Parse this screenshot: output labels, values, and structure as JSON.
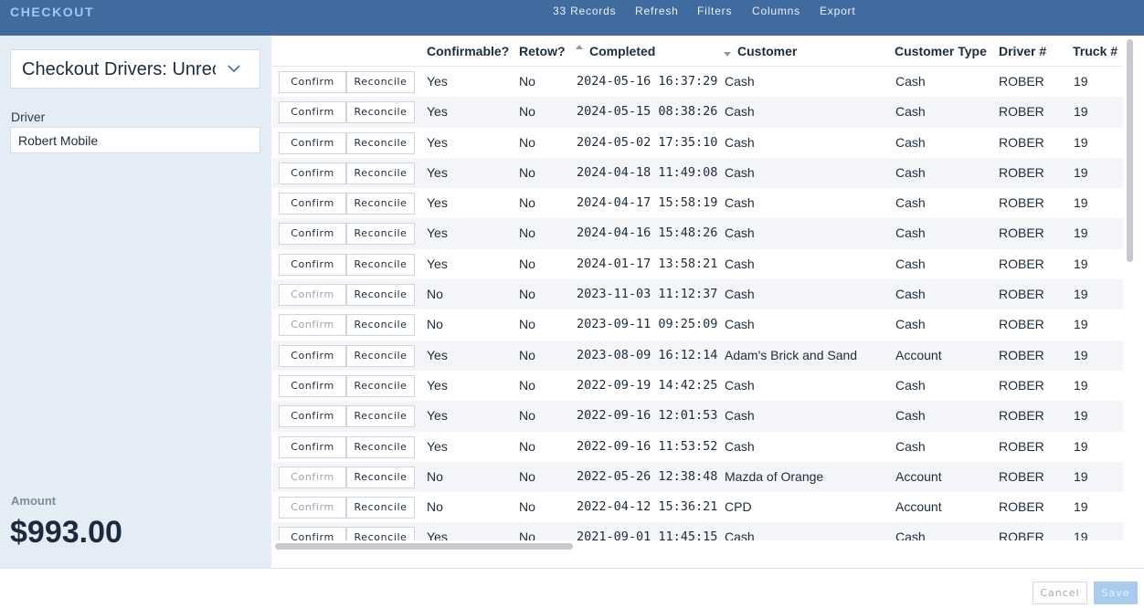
{
  "app": {
    "title": "CHECKOUT"
  },
  "nav": {
    "records": "33 Records",
    "refresh": "Refresh",
    "filters": "Filters",
    "columns": "Columns",
    "export": "Export"
  },
  "sidebar": {
    "view_select": "Checkout Drivers: Unreconciled",
    "driver_label": "Driver",
    "driver_value": "Robert Mobile",
    "amount_label": "Amount",
    "amount_value": "$993.00"
  },
  "table": {
    "columns": [
      "Confirmable?",
      "Retow?",
      "Completed",
      "Customer",
      "Customer Type",
      "Driver #",
      "Truck #"
    ],
    "sort": {
      "completed": "ascending-indicator",
      "customer": "descending-indicator"
    },
    "confirm_label": "Confirm",
    "reconcile_label": "Reconcile",
    "rows": [
      {
        "confirmable": "Yes",
        "retow": "No",
        "completed": "2024-05-16 16:37:29",
        "customer": "Cash",
        "type": "Cash",
        "driver": "ROBER",
        "truck": "19",
        "confirm_enabled": true
      },
      {
        "confirmable": "Yes",
        "retow": "No",
        "completed": "2024-05-15 08:38:26",
        "customer": "Cash",
        "type": "Cash",
        "driver": "ROBER",
        "truck": "19",
        "confirm_enabled": true
      },
      {
        "confirmable": "Yes",
        "retow": "No",
        "completed": "2024-05-02 17:35:10",
        "customer": "Cash",
        "type": "Cash",
        "driver": "ROBER",
        "truck": "19",
        "confirm_enabled": true
      },
      {
        "confirmable": "Yes",
        "retow": "No",
        "completed": "2024-04-18 11:49:08",
        "customer": "Cash",
        "type": "Cash",
        "driver": "ROBER",
        "truck": "19",
        "confirm_enabled": true
      },
      {
        "confirmable": "Yes",
        "retow": "No",
        "completed": "2024-04-17 15:58:19",
        "customer": "Cash",
        "type": "Cash",
        "driver": "ROBER",
        "truck": "19",
        "confirm_enabled": true
      },
      {
        "confirmable": "Yes",
        "retow": "No",
        "completed": "2024-04-16 15:48:26",
        "customer": "Cash",
        "type": "Cash",
        "driver": "ROBER",
        "truck": "19",
        "confirm_enabled": true
      },
      {
        "confirmable": "Yes",
        "retow": "No",
        "completed": "2024-01-17 13:58:21",
        "customer": "Cash",
        "type": "Cash",
        "driver": "ROBER",
        "truck": "19",
        "confirm_enabled": true
      },
      {
        "confirmable": "No",
        "retow": "No",
        "completed": "2023-11-03 11:12:37",
        "customer": "Cash",
        "type": "Cash",
        "driver": "ROBER",
        "truck": "19",
        "confirm_enabled": false
      },
      {
        "confirmable": "No",
        "retow": "No",
        "completed": "2023-09-11 09:25:09",
        "customer": "Cash",
        "type": "Cash",
        "driver": "ROBER",
        "truck": "19",
        "confirm_enabled": false
      },
      {
        "confirmable": "Yes",
        "retow": "No",
        "completed": "2023-08-09 16:12:14",
        "customer": "Adam's Brick and Sand",
        "type": "Account",
        "driver": "ROBER",
        "truck": "19",
        "confirm_enabled": true
      },
      {
        "confirmable": "Yes",
        "retow": "No",
        "completed": "2022-09-19 14:42:25",
        "customer": "Cash",
        "type": "Cash",
        "driver": "ROBER",
        "truck": "19",
        "confirm_enabled": true
      },
      {
        "confirmable": "Yes",
        "retow": "No",
        "completed": "2022-09-16 12:01:53",
        "customer": "Cash",
        "type": "Cash",
        "driver": "ROBER",
        "truck": "19",
        "confirm_enabled": true
      },
      {
        "confirmable": "Yes",
        "retow": "No",
        "completed": "2022-09-16 11:53:52",
        "customer": "Cash",
        "type": "Cash",
        "driver": "ROBER",
        "truck": "19",
        "confirm_enabled": true
      },
      {
        "confirmable": "No",
        "retow": "No",
        "completed": "2022-05-26 12:38:48",
        "customer": "Mazda of Orange",
        "type": "Account",
        "driver": "ROBER",
        "truck": "19",
        "confirm_enabled": false
      },
      {
        "confirmable": "No",
        "retow": "No",
        "completed": "2022-04-12 15:36:21",
        "customer": "CPD",
        "type": "Account",
        "driver": "ROBER",
        "truck": "19",
        "confirm_enabled": false
      },
      {
        "confirmable": "Yes",
        "retow": "No",
        "completed": "2021-09-01 11:45:15",
        "customer": "Cash",
        "type": "Cash",
        "driver": "ROBER",
        "truck": "19",
        "confirm_enabled": true
      }
    ]
  },
  "footer": {
    "cancel": "Cancel",
    "save": "Save"
  },
  "colors": {
    "header_bg": "#3f6b9e",
    "brand": "#9cc9f2",
    "sidebar_bg": "#e4ecf5",
    "save_bg": "#a9cbee",
    "alt_row": "#f3f5f8"
  }
}
